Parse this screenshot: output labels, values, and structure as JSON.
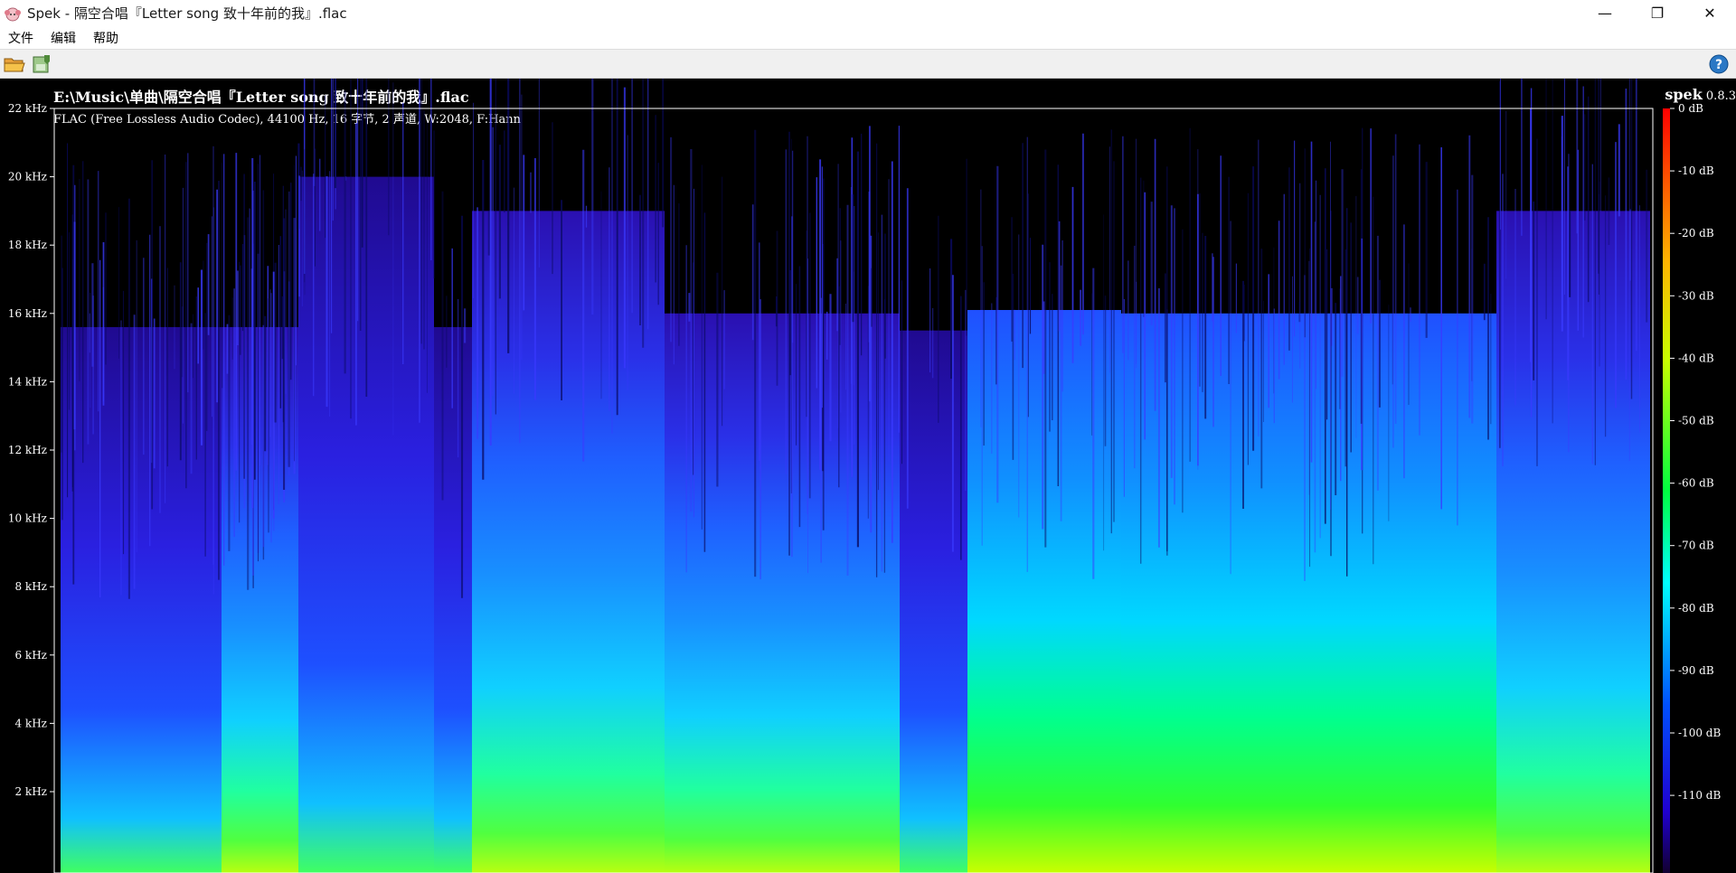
{
  "window": {
    "title": "Spek - 隔空合唱『Letter song 致十年前的我』.flac",
    "controls": {
      "minimize": "—",
      "restore": "❐",
      "close": "✕"
    }
  },
  "menu": {
    "items": [
      "文件",
      "编辑",
      "帮助"
    ]
  },
  "toolbar": {
    "buttons": [
      {
        "icon": "open-folder-icon"
      },
      {
        "icon": "save-image-icon"
      }
    ],
    "help_icon": "help-icon"
  },
  "spectrogram": {
    "file_path": "E:\\Music\\单曲\\隔空合唱『Letter song 致十年前的我』.flac",
    "file_info": "FLAC (Free Lossless Audio Codec), 44100 Hz, 16 字节, 2 声道, W:2048, F:Hann",
    "brand_name": "spek",
    "brand_version": " 0.8.3",
    "freq_ticks": [
      "22 kHz",
      "20 kHz",
      "18 kHz",
      "16 kHz",
      "14 kHz",
      "12 kHz",
      "10 kHz",
      "8 kHz",
      "6 kHz",
      "4 kHz",
      "2 kHz"
    ],
    "db_ticks": [
      "0 dB",
      "-10 dB",
      "-20 dB",
      "-30 dB",
      "-40 dB",
      "-50 dB",
      "-60 dB",
      "-70 dB",
      "-80 dB",
      "-90 dB",
      "-100 dB",
      "-110 dB"
    ],
    "colors": {
      "background": "#000000",
      "axis": "#ffffff"
    }
  }
}
